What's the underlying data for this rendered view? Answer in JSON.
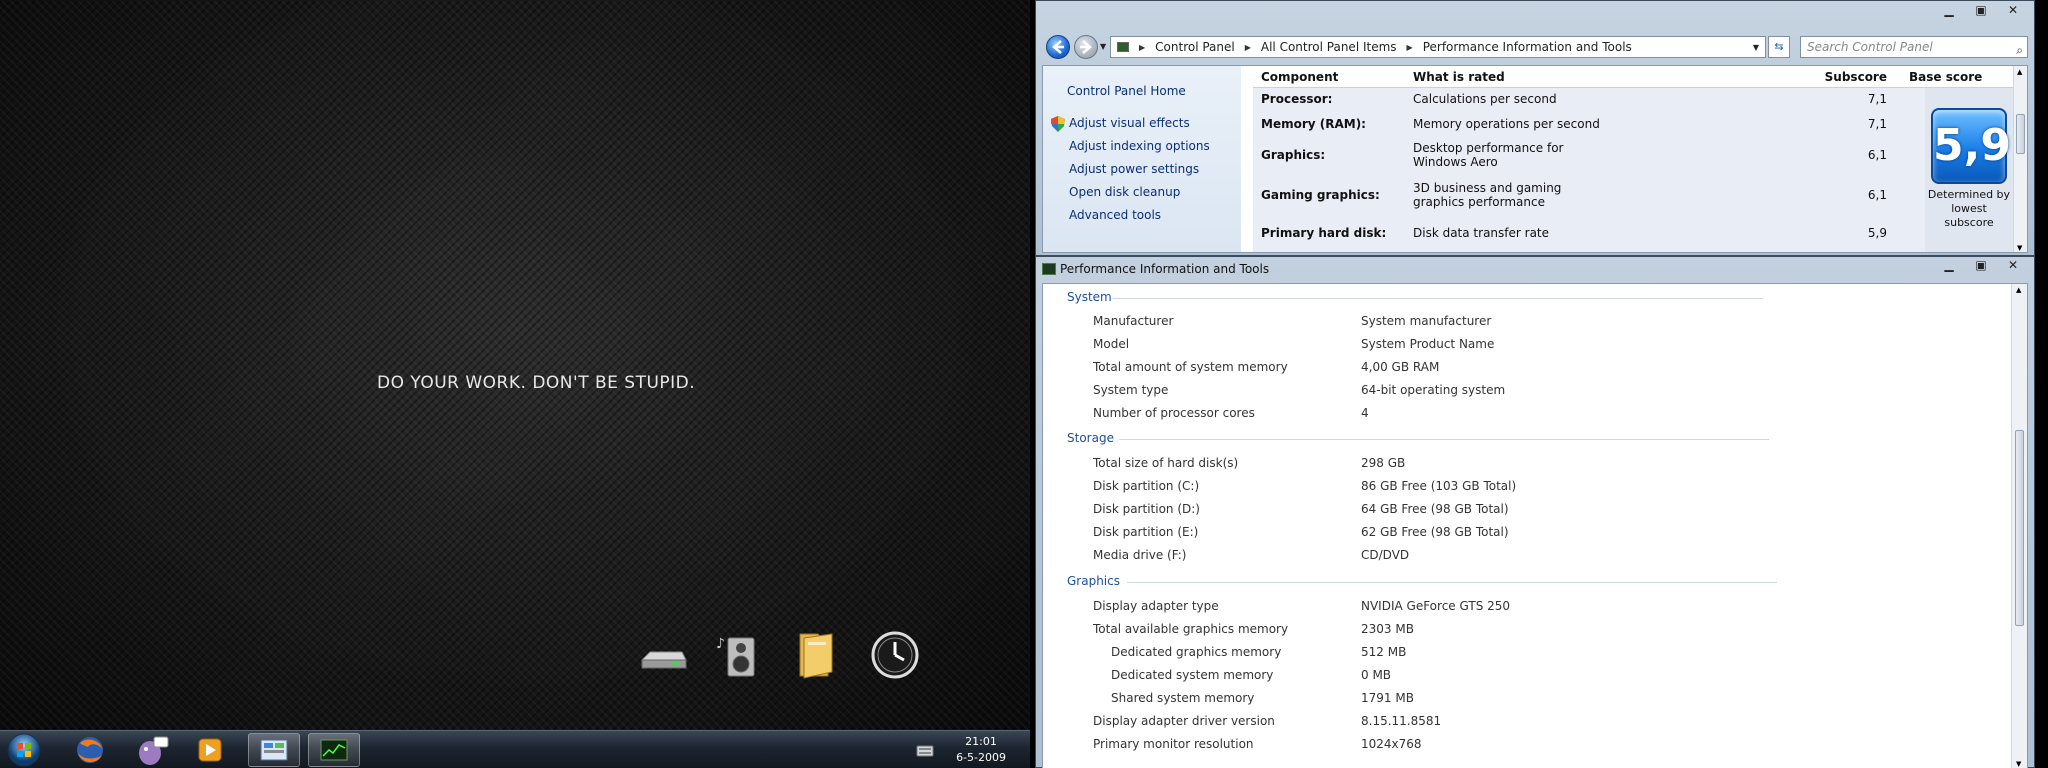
{
  "desktop": {
    "slogan": "DO YOUR WORK. DON'T BE STUPID.",
    "dock_icons": [
      "drive-icon",
      "speaker-icon",
      "folder-icon",
      "clock-icon"
    ]
  },
  "taskbar": {
    "time": "21:01",
    "date": "6-5-2009"
  },
  "control_panel": {
    "address": [
      "Control Panel",
      "All Control Panel Items",
      "Performance Information and Tools"
    ],
    "search_placeholder": "Search Control Panel",
    "nav": {
      "home": "Control Panel Home",
      "links": [
        "Adjust visual effects",
        "Adjust indexing options",
        "Adjust power settings",
        "Open disk cleanup",
        "Advanced tools"
      ]
    },
    "table": {
      "headers": {
        "component": "Component",
        "what": "What is rated",
        "subscore": "Subscore",
        "base": "Base score"
      },
      "rows": [
        {
          "component": "Processor:",
          "what": "Calculations per second",
          "subscore": "7,1"
        },
        {
          "component": "Memory (RAM):",
          "what": "Memory operations per second",
          "subscore": "7,1"
        },
        {
          "component": "Graphics:",
          "what": "Desktop performance for Windows Aero",
          "subscore": "6,1"
        },
        {
          "component": "Gaming graphics:",
          "what": "3D business and gaming graphics performance",
          "subscore": "6,1"
        },
        {
          "component": "Primary hard disk:",
          "what": "Disk data transfer rate",
          "subscore": "5,9"
        }
      ],
      "base_score": "5,9",
      "base_caption": "Determined by lowest subscore"
    }
  },
  "details_window": {
    "title": "Performance Information and Tools",
    "sections": {
      "system": {
        "heading": "System",
        "items": [
          {
            "label": "Manufacturer",
            "value": "System manufacturer"
          },
          {
            "label": "Model",
            "value": "System Product Name"
          },
          {
            "label": "Total amount of system memory",
            "value": "4,00 GB RAM"
          },
          {
            "label": "System type",
            "value": "64-bit operating system"
          },
          {
            "label": "Number of processor cores",
            "value": "4"
          }
        ]
      },
      "storage": {
        "heading": "Storage",
        "items": [
          {
            "label": "Total size of hard disk(s)",
            "value": "298 GB"
          },
          {
            "label": "Disk partition (C:)",
            "value": "86 GB Free (103 GB Total)"
          },
          {
            "label": "Disk partition (D:)",
            "value": "64 GB Free (98 GB Total)"
          },
          {
            "label": "Disk partition (E:)",
            "value": "62 GB Free (98 GB Total)"
          },
          {
            "label": "Media drive (F:)",
            "value": "CD/DVD"
          }
        ]
      },
      "graphics": {
        "heading": "Graphics",
        "items": [
          {
            "label": "Display adapter type",
            "value": "NVIDIA GeForce GTS 250"
          },
          {
            "label": "Total available graphics memory",
            "value": "2303 MB"
          },
          {
            "label": "Dedicated graphics memory",
            "value": "512 MB"
          },
          {
            "label": "Dedicated system memory",
            "value": "0 MB"
          },
          {
            "label": "Shared system memory",
            "value": "1791 MB"
          },
          {
            "label": "Display adapter driver version",
            "value": "8.15.11.8581"
          },
          {
            "label": "Primary monitor resolution",
            "value": "1024x768"
          }
        ]
      }
    }
  }
}
